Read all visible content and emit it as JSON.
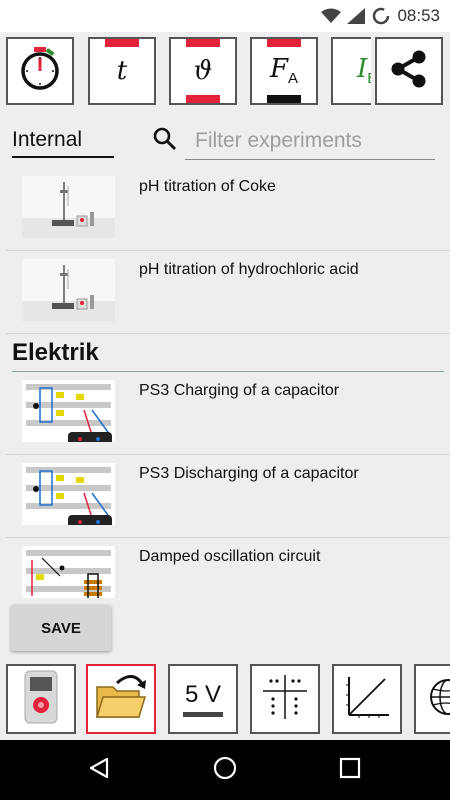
{
  "status_bar": {
    "time": "08:53",
    "icons": [
      "wifi-icon",
      "signal-icon",
      "battery-loading-icon"
    ]
  },
  "toolbar": {
    "tools": [
      {
        "name": "stopwatch",
        "icon": "stopwatch-icon"
      },
      {
        "name": "time",
        "symbol": "t"
      },
      {
        "name": "temperature",
        "symbol": "ϑ"
      },
      {
        "name": "force",
        "symbol": "F",
        "sub": "A"
      },
      {
        "name": "current",
        "symbol": "I",
        "sub": "B"
      }
    ],
    "share_icon": "share-icon"
  },
  "filter": {
    "source_label": "Internal",
    "placeholder": "Filter experiments",
    "value": ""
  },
  "experiments": {
    "items_top": [
      {
        "title": "pH titration of Coke",
        "thumb": "chemistry-setup"
      },
      {
        "title": "pH titration of hydrochloric acid",
        "thumb": "chemistry-setup"
      }
    ],
    "section_title": "Elektrik",
    "items_electric": [
      {
        "title": "PS3 Charging of a capacitor",
        "thumb": "circuit-board"
      },
      {
        "title": "PS3 Discharging of a capacitor",
        "thumb": "circuit-board"
      },
      {
        "title": "Damped oscillation circuit",
        "thumb": "circuit-board"
      }
    ]
  },
  "save_label": "SAVE",
  "bottom_toolbar": {
    "tools": [
      {
        "name": "device",
        "icon": "measuring-device-icon"
      },
      {
        "name": "open",
        "icon": "open-folder-icon",
        "active": true
      },
      {
        "name": "voltage",
        "label": "5 V"
      },
      {
        "name": "table",
        "icon": "table-icon"
      },
      {
        "name": "graph",
        "icon": "graph-icon"
      },
      {
        "name": "web",
        "icon": "globe-icon"
      }
    ]
  },
  "colors": {
    "accent_red": "#e2233b",
    "background": "#eeeeee",
    "current_green": "#2e8b2e"
  }
}
